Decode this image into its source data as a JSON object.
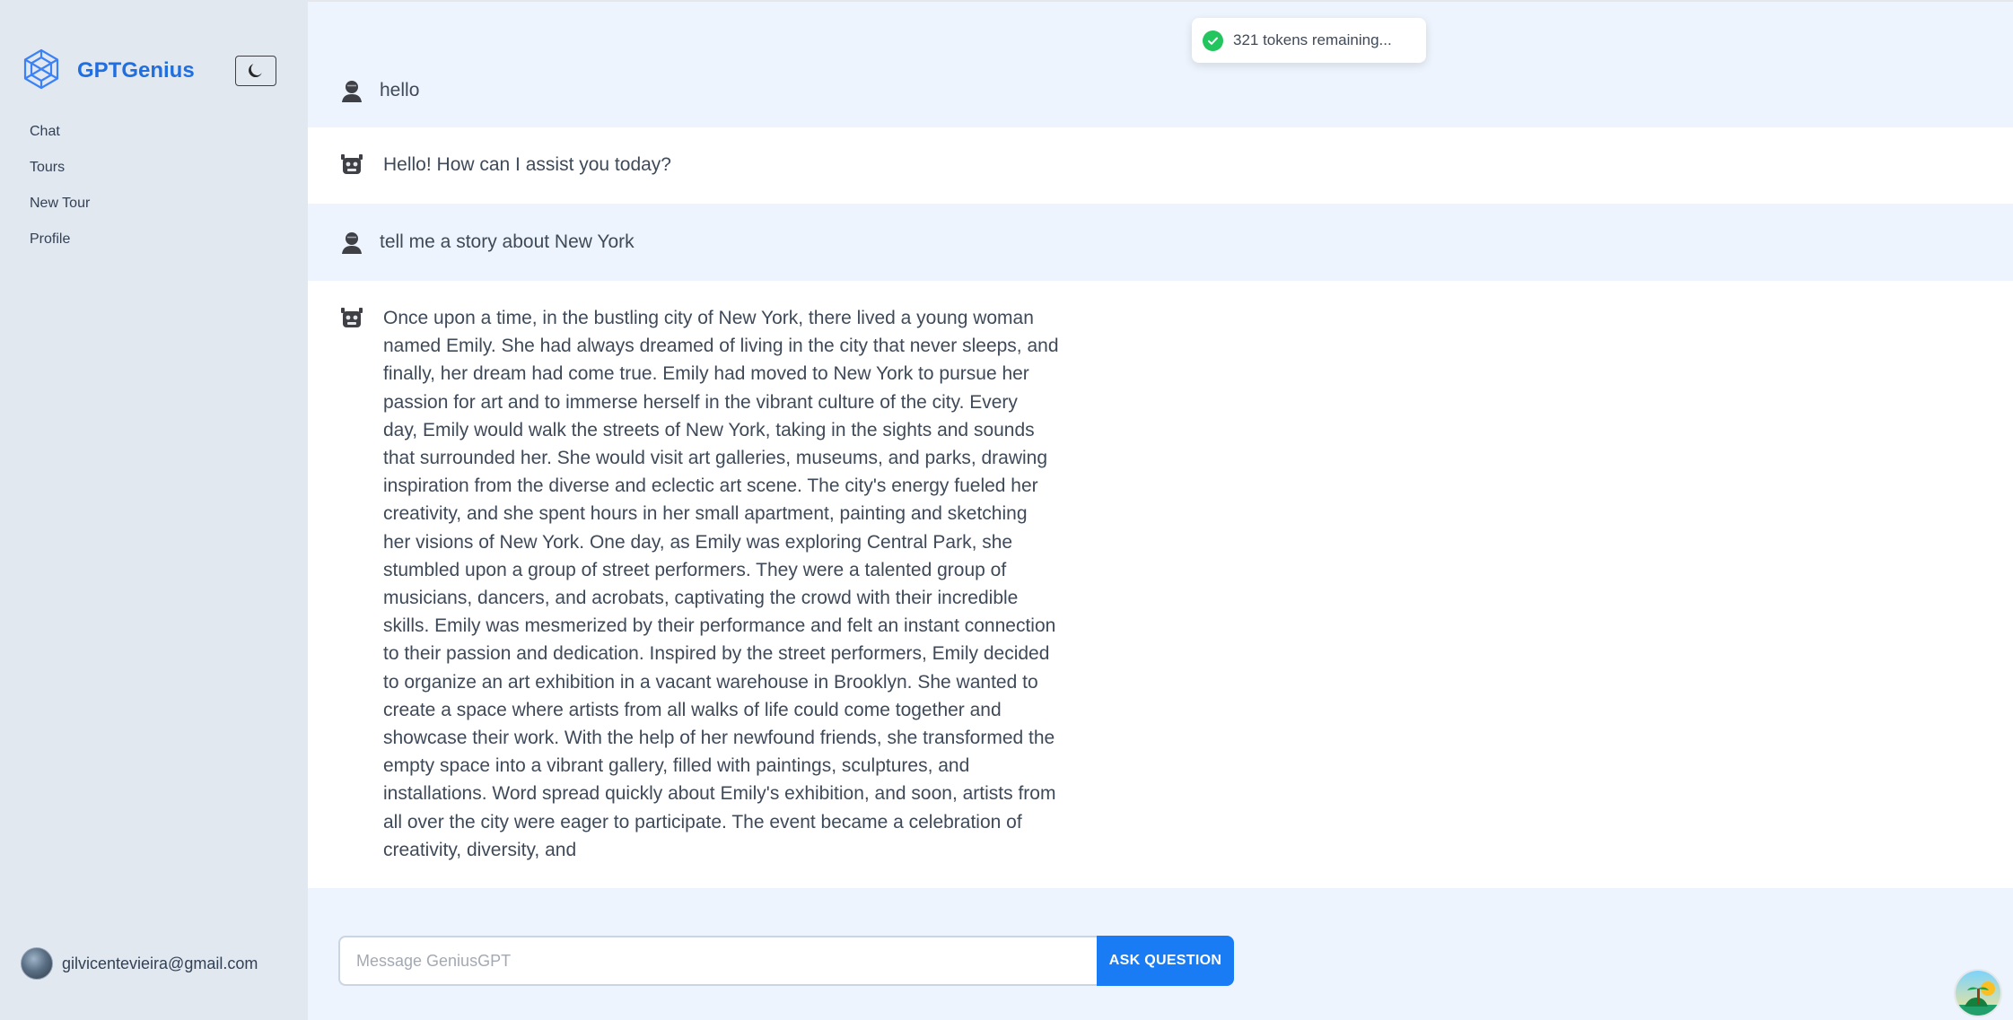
{
  "app": {
    "title": "GPTGenius",
    "brand_color": "#1f6fe0"
  },
  "sidebar": {
    "items": [
      {
        "label": "Chat"
      },
      {
        "label": "Tours"
      },
      {
        "label": "New Tour"
      },
      {
        "label": "Profile"
      }
    ],
    "user_email": "gilvicentevieira@gmail.com"
  },
  "toast": {
    "text": "321 tokens remaining...",
    "status_color": "#22c55e"
  },
  "messages": [
    {
      "role": "user",
      "text": "hello"
    },
    {
      "role": "assistant",
      "text": "Hello! How can I assist you today?"
    },
    {
      "role": "user",
      "text": "tell me a story about New York"
    },
    {
      "role": "assistant",
      "text": "Once upon a time, in the bustling city of New York, there lived a young woman\nnamed Emily. She had always dreamed of living in the city that never sleeps, and\nfinally, her dream had come true. Emily had moved to New York to pursue her\npassion for art and to immerse herself in the vibrant culture of the city. Every\nday, Emily would walk the streets of New York, taking in the sights and sounds\nthat surrounded her. She would visit art galleries, museums, and parks, drawing\ninspiration from the diverse and eclectic art scene. The city's energy fueled her\ncreativity, and she spent hours in her small apartment, painting and sketching\nher visions of New York. One day, as Emily was exploring Central Park, she\nstumbled upon a group of street performers. They were a talented group of\nmusicians, dancers, and acrobats, captivating the crowd with their incredible\nskills. Emily was mesmerized by their performance and felt an instant connection\nto their passion and dedication. Inspired by the street performers, Emily decided\nto organize an art exhibition in a vacant warehouse in Brooklyn. She wanted to\ncreate a space where artists from all walks of life could come together and\nshowcase their work. With the help of her newfound friends, she transformed the\nempty space into a vibrant gallery, filled with paintings, sculptures, and\ninstallations. Word spread quickly about Emily's exhibition, and soon, artists from\nall over the city were eager to participate. The event became a celebration of\ncreativity, diversity, and"
    }
  ],
  "composer": {
    "placeholder": "Message GeniusGPT",
    "value": "",
    "button_label": "ASK QUESTION",
    "button_color": "#1a7cf5"
  },
  "icons": {
    "brand": "hexagon-network-icon",
    "theme_toggle": "moon-icon",
    "user_message": "user-icon",
    "assistant_message": "robot-icon",
    "toast": "check-circle-icon"
  }
}
